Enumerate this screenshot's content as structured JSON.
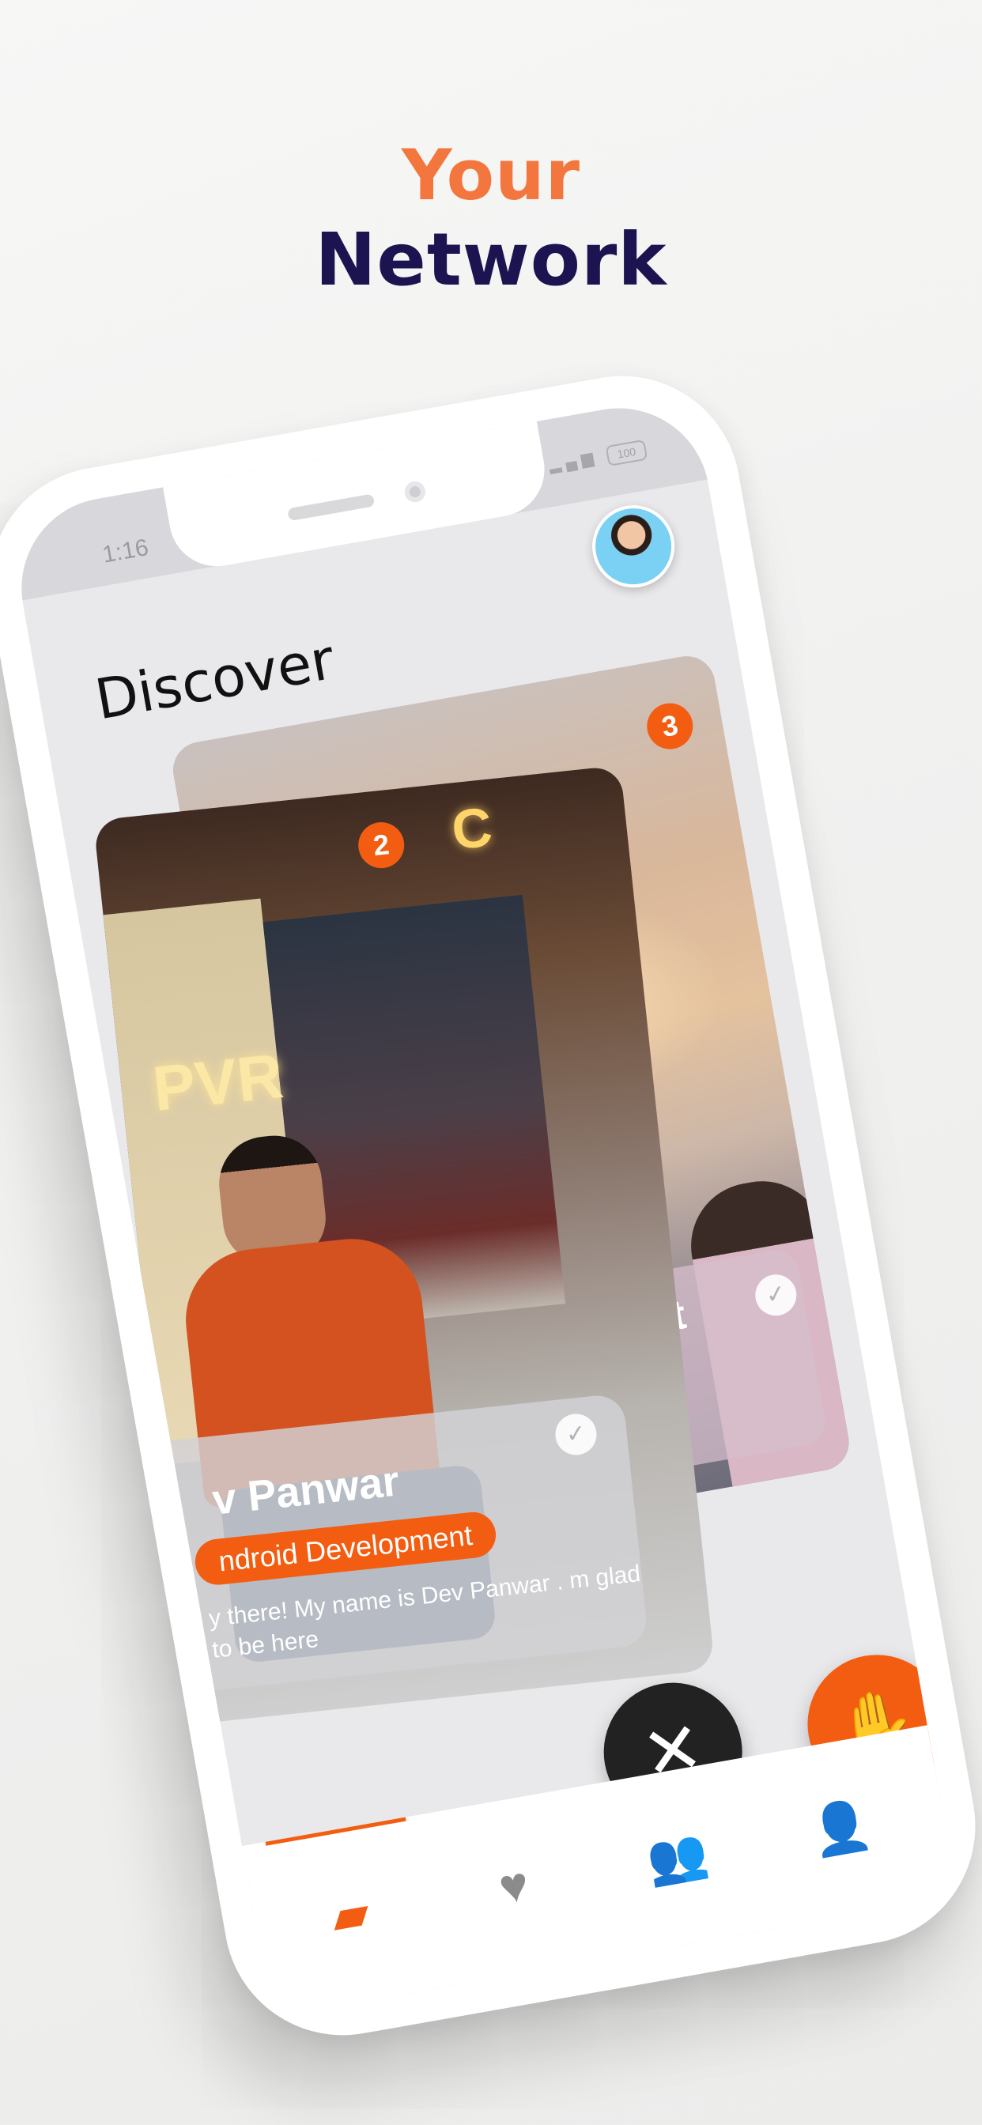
{
  "headline": {
    "line1": "Your",
    "line2": "Network"
  },
  "status_bar": {
    "time": "1:16",
    "battery": "100"
  },
  "screen": {
    "title": "Discover"
  },
  "cards": {
    "back": {
      "badge": "3",
      "partial_title": "nt"
    },
    "front": {
      "badge": "2",
      "name": "v Panwar",
      "tag": "ndroid Development",
      "bio": "y there! My name is Dev Panwar . m glad to be here"
    }
  },
  "actions": {
    "reject_icon": "close-icon",
    "wave_icon": "wave-hand-icon",
    "undo_icon": "refresh-icon"
  },
  "tabs": [
    {
      "icon": "cards-icon",
      "active": true
    },
    {
      "icon": "heart-icon",
      "active": false
    },
    {
      "icon": "people-icon",
      "active": false
    },
    {
      "icon": "person-icon",
      "active": false
    }
  ],
  "colors": {
    "accent": "#f35d11",
    "headline_orange": "#f4763f",
    "headline_navy": "#1c1450"
  }
}
